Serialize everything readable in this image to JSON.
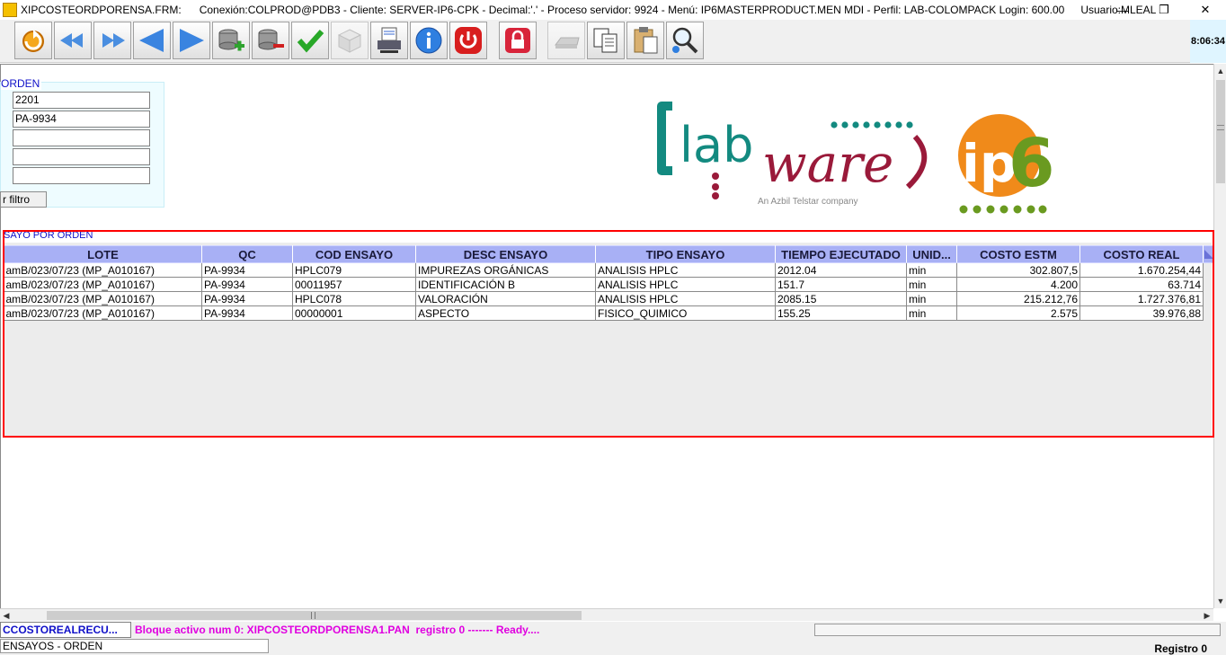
{
  "window": {
    "app_name": "XIPCOSTEORDPORENSA.FRM:",
    "title_info": "Conexión:COLPROD@PDB3 - Cliente: SERVER-IP6-CPK - Decimal:'.' - Proceso servidor: 9924 - Menú: IP6MASTERPRODUCT.MEN MDI - Perfil: LAB-COLOMPACK Login: 600.00",
    "user": "Usuario:MLEAL",
    "controls": {
      "minimize": "—",
      "restore": "❐",
      "close": "✕"
    }
  },
  "toolbar": {
    "clock": "8:06:34",
    "buttons": [
      {
        "name": "refresh-button",
        "icon": "refresh-icon",
        "enabled": true
      },
      {
        "name": "first-record-button",
        "icon": "double-left-arrow-icon",
        "enabled": true
      },
      {
        "name": "last-record-button",
        "icon": "double-right-arrow-icon",
        "enabled": true
      },
      {
        "name": "previous-record-button",
        "icon": "left-triangle-icon",
        "enabled": true
      },
      {
        "name": "next-record-button",
        "icon": "right-triangle-icon",
        "enabled": true
      },
      {
        "name": "insert-record-button",
        "icon": "database-add-icon",
        "enabled": true
      },
      {
        "name": "delete-record-button",
        "icon": "database-remove-icon",
        "enabled": true
      },
      {
        "name": "accept-button",
        "icon": "checkmark-icon",
        "enabled": true
      },
      {
        "name": "package-button",
        "icon": "box-icon",
        "enabled": false
      },
      {
        "name": "print-button",
        "icon": "printer-icon",
        "enabled": true
      },
      {
        "name": "info-button",
        "icon": "info-icon",
        "enabled": true
      },
      {
        "name": "exit-button",
        "icon": "power-icon",
        "enabled": true
      },
      {
        "name": "lock-button",
        "icon": "lock-icon",
        "enabled": true
      },
      {
        "name": "cut-button",
        "icon": "eraser-icon",
        "enabled": false
      },
      {
        "name": "copy-button",
        "icon": "copy-icon",
        "enabled": true
      },
      {
        "name": "paste-button",
        "icon": "clipboard-icon",
        "enabled": true
      },
      {
        "name": "search-button",
        "icon": "magnifier-icon",
        "enabled": true
      }
    ]
  },
  "orden": {
    "label": "ORDEN",
    "fields": [
      "2201",
      "PA-9934",
      "",
      "",
      ""
    ],
    "filter_button": "r filtro"
  },
  "logo": {
    "brand": "labware",
    "tagline": "An Azbil Telstar company",
    "product": "ip6"
  },
  "ensayo": {
    "label": "SAYO POR ORDEN",
    "columns": [
      "LOTE",
      "QC",
      "COD ENSAYO",
      "DESC ENSAYO",
      "TIPO ENSAYO",
      "TIEMPO EJECUTADO",
      "UNID...",
      "COSTO ESTM",
      "COSTO REAL"
    ],
    "rows": [
      [
        "amB/023/07/23 (MP_A010167)",
        "PA-9934",
        "HPLC079",
        "IMPUREZAS ORGÁNICAS",
        "ANALISIS HPLC",
        "2012.04",
        "min",
        "302.807,5",
        "1.670.254,44"
      ],
      [
        "amB/023/07/23 (MP_A010167)",
        "PA-9934",
        "00011957",
        "IDENTIFICACIÓN B",
        "ANALISIS HPLC",
        "151.7",
        "min",
        "4.200",
        "63.714"
      ],
      [
        "amB/023/07/23 (MP_A010167)",
        "PA-9934",
        "HPLC078",
        "VALORACIÓN",
        "ANALISIS HPLC",
        "2085.15",
        "min",
        "215.212,76",
        "1.727.376,81"
      ],
      [
        "amB/023/07/23 (MP_A010167)",
        "PA-9934",
        "00000001",
        "ASPECTO",
        "FISICO_QUIMICO",
        "155.25",
        "min",
        "2.575",
        "39.976,88"
      ]
    ]
  },
  "status": {
    "block": "CCOSTOREALRECU...",
    "message": "Bloque activo num 0: XIPCOSTEORDPORENSA1.PAN  registro 0 ------- Ready....",
    "form_label": "ENSAYOS - ORDEN",
    "registro": "Registro 0"
  },
  "colors": {
    "accent_blue": "#1010c8",
    "grid_header": "#a8b0f5",
    "status_magenta": "#e000e0",
    "highlight_red": "#ff0000",
    "labware_teal": "#138a80",
    "labware_maroon": "#9a1a3a",
    "ip6_orange": "#f08a1a",
    "ip6_green": "#6a9a20"
  }
}
